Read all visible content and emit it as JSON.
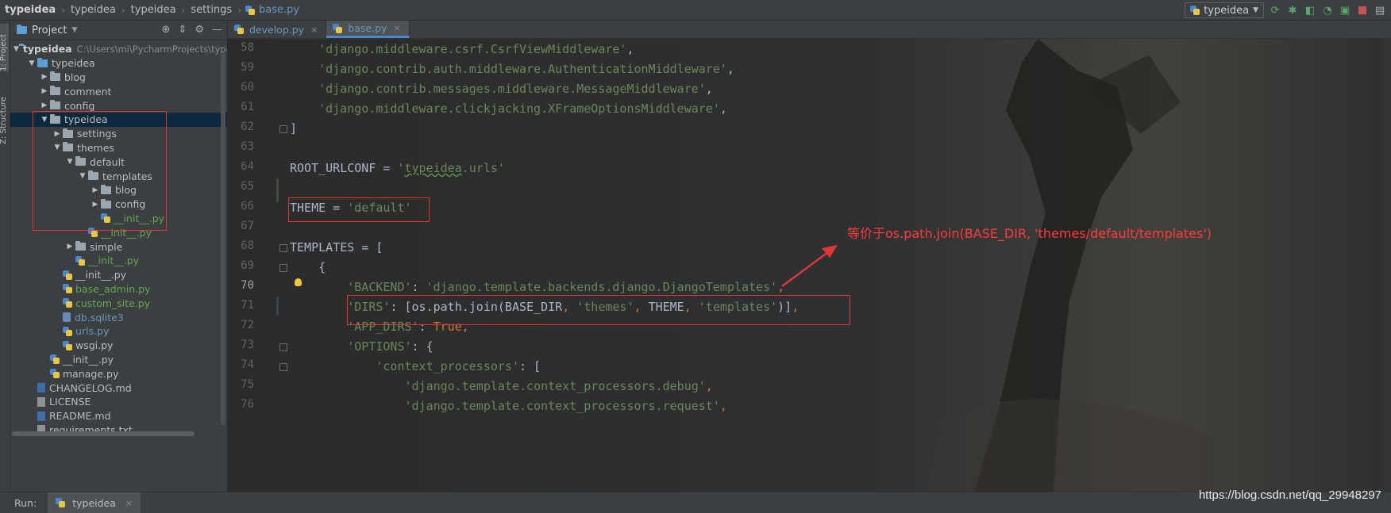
{
  "breadcrumbs": [
    "typeidea",
    "typeidea",
    "typeidea",
    "settings",
    "base.py"
  ],
  "run_config": "typeidea",
  "icons": {
    "rerun": "rerun-icon",
    "debug": "debug-icon",
    "coverage": "coverage-icon",
    "profile": "profile-icon",
    "build": "build-icon",
    "stop": "stop-icon"
  },
  "stripe": {
    "project": "1: Project",
    "structure": "Z: Structure"
  },
  "panel": {
    "title": "Project"
  },
  "tree": [
    {
      "name": "typeidea",
      "path": "C:\\Users\\mi\\PycharmProjects\\typeide",
      "depth": 0,
      "arrow": "down",
      "type": "folder-blue",
      "style": "bold"
    },
    {
      "name": "typeidea",
      "depth": 1,
      "arrow": "down",
      "type": "folder-blue"
    },
    {
      "name": "blog",
      "depth": 2,
      "arrow": "right",
      "type": "folder"
    },
    {
      "name": "comment",
      "depth": 2,
      "arrow": "right",
      "type": "folder"
    },
    {
      "name": "config",
      "depth": 2,
      "arrow": "right",
      "type": "folder"
    },
    {
      "name": "typeidea",
      "depth": 2,
      "arrow": "down",
      "type": "folder",
      "selected": true
    },
    {
      "name": "settings",
      "depth": 3,
      "arrow": "right",
      "type": "folder"
    },
    {
      "name": "themes",
      "depth": 3,
      "arrow": "down",
      "type": "folder"
    },
    {
      "name": "default",
      "depth": 4,
      "arrow": "down",
      "type": "folder"
    },
    {
      "name": "templates",
      "depth": 5,
      "arrow": "down",
      "type": "folder"
    },
    {
      "name": "blog",
      "depth": 6,
      "arrow": "right",
      "type": "folder"
    },
    {
      "name": "config",
      "depth": 6,
      "arrow": "right",
      "type": "folder"
    },
    {
      "name": "__init__.py",
      "depth": 6,
      "arrow": "none",
      "type": "py",
      "style": "green"
    },
    {
      "name": "__init__.py",
      "depth": 5,
      "arrow": "none",
      "type": "py",
      "style": "green"
    },
    {
      "name": "simple",
      "depth": 4,
      "arrow": "right",
      "type": "folder"
    },
    {
      "name": "__init__.py",
      "depth": 4,
      "arrow": "none",
      "type": "py",
      "style": "green"
    },
    {
      "name": "__init__.py",
      "depth": 3,
      "arrow": "none",
      "type": "py"
    },
    {
      "name": "base_admin.py",
      "depth": 3,
      "arrow": "none",
      "type": "py",
      "style": "green"
    },
    {
      "name": "custom_site.py",
      "depth": 3,
      "arrow": "none",
      "type": "py",
      "style": "green"
    },
    {
      "name": "db.sqlite3",
      "depth": 3,
      "arrow": "none",
      "type": "db",
      "style": "blue"
    },
    {
      "name": "urls.py",
      "depth": 3,
      "arrow": "none",
      "type": "py",
      "style": "blue"
    },
    {
      "name": "wsgi.py",
      "depth": 3,
      "arrow": "none",
      "type": "py"
    },
    {
      "name": "__init__.py",
      "depth": 2,
      "arrow": "none",
      "type": "py"
    },
    {
      "name": "manage.py",
      "depth": 2,
      "arrow": "none",
      "type": "py"
    },
    {
      "name": "CHANGELOG.md",
      "depth": 1,
      "arrow": "none",
      "type": "md"
    },
    {
      "name": "LICENSE",
      "depth": 1,
      "arrow": "none",
      "type": "txt"
    },
    {
      "name": "README.md",
      "depth": 1,
      "arrow": "none",
      "type": "md"
    },
    {
      "name": "requirements.txt",
      "depth": 1,
      "arrow": "none",
      "type": "txt"
    }
  ],
  "tabs": [
    {
      "label": "develop.py",
      "active": false
    },
    {
      "label": "base.py",
      "active": true
    }
  ],
  "editor": {
    "current_line": 70,
    "lines": [
      {
        "n": 58,
        "indent": 4,
        "tokens": [
          [
            "s",
            "'django.middleware.csrf.CsrfViewMiddleware'"
          ],
          [
            "p",
            ","
          ]
        ]
      },
      {
        "n": 59,
        "indent": 4,
        "tokens": [
          [
            "s",
            "'django.contrib.auth.middleware.AuthenticationMiddleware'"
          ],
          [
            "p",
            ","
          ]
        ]
      },
      {
        "n": 60,
        "indent": 4,
        "tokens": [
          [
            "s",
            "'django.contrib.messages.middleware.MessageMiddleware'"
          ],
          [
            "p",
            ","
          ]
        ]
      },
      {
        "n": 61,
        "indent": 4,
        "tokens": [
          [
            "s",
            "'django.middleware.clickjacking.XFrameOptionsMiddleware'"
          ],
          [
            "p",
            ","
          ]
        ]
      },
      {
        "n": 62,
        "indent": 0,
        "tokens": [
          [
            "p",
            "]"
          ]
        ],
        "fold": true
      },
      {
        "n": 63,
        "indent": 0,
        "tokens": []
      },
      {
        "n": 64,
        "indent": 0,
        "tokens": [
          [
            "p",
            "ROOT_URLCONF = "
          ],
          [
            "s",
            "'"
          ],
          [
            "su",
            "typeidea"
          ],
          [
            "s",
            ".urls'"
          ]
        ]
      },
      {
        "n": 65,
        "indent": 0,
        "tokens": []
      },
      {
        "n": 66,
        "indent": 0,
        "tokens": [
          [
            "p",
            "THEME = "
          ],
          [
            "s",
            "'default'"
          ]
        ]
      },
      {
        "n": 67,
        "indent": 0,
        "tokens": []
      },
      {
        "n": 68,
        "indent": 0,
        "tokens": [
          [
            "p",
            "TEMPLATES = ["
          ]
        ],
        "fold": true
      },
      {
        "n": 69,
        "indent": 4,
        "tokens": [
          [
            "p",
            "{"
          ]
        ],
        "fold": true
      },
      {
        "n": 70,
        "indent": 8,
        "tokens": [
          [
            "s",
            "'BACKEND'"
          ],
          [
            "p",
            ": "
          ],
          [
            "s",
            "'django.template.backends.django.DjangoTemplates'"
          ],
          [
            "k",
            ","
          ]
        ]
      },
      {
        "n": 71,
        "indent": 8,
        "tokens": [
          [
            "s",
            "'DIRS'"
          ],
          [
            "p",
            ": [os.path.join(BASE_DIR"
          ],
          [
            "k",
            ", "
          ],
          [
            "s",
            "'themes'"
          ],
          [
            "k",
            ", "
          ],
          [
            "p",
            "THEME"
          ],
          [
            "k",
            ", "
          ],
          [
            "s",
            "'templates'"
          ],
          [
            "p",
            ")]"
          ],
          [
            "k",
            ","
          ]
        ]
      },
      {
        "n": 72,
        "indent": 8,
        "tokens": [
          [
            "s",
            "'APP_DIRS'"
          ],
          [
            "p",
            ": "
          ],
          [
            "k",
            "True,"
          ]
        ]
      },
      {
        "n": 73,
        "indent": 8,
        "tokens": [
          [
            "s",
            "'OPTIONS'"
          ],
          [
            "p",
            ": {"
          ]
        ],
        "fold": true
      },
      {
        "n": 74,
        "indent": 12,
        "tokens": [
          [
            "s",
            "'context_processors'"
          ],
          [
            "p",
            ": ["
          ]
        ],
        "fold": true
      },
      {
        "n": 75,
        "indent": 16,
        "tokens": [
          [
            "s",
            "'django.template.context_processors.debug'"
          ],
          [
            "k",
            ","
          ]
        ]
      },
      {
        "n": 76,
        "indent": 16,
        "tokens": [
          [
            "s",
            "'django.template.context_processors.request'"
          ],
          [
            "k",
            ","
          ]
        ]
      }
    ]
  },
  "annotation": "等价于os.path.join(BASE_DIR, 'themes/default/templates')",
  "bottom": {
    "run_label": "Run:",
    "run_tab": "typeidea"
  },
  "watermark": "https://blog.csdn.net/qq_29948297",
  "colors": {
    "string": "#6a8759",
    "keyword": "#cc7832",
    "annotation": "#ff3b3b",
    "selection": "#0d293e"
  }
}
